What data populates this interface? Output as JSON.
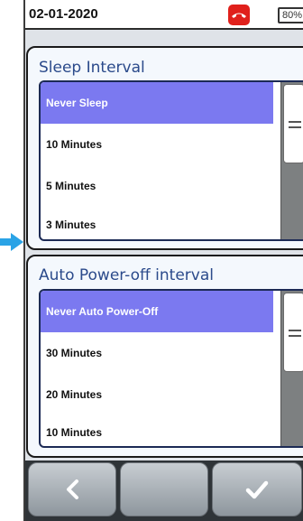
{
  "status": {
    "date": "02-01-2020",
    "battery": "80%"
  },
  "sleep_interval": {
    "title": "Sleep Interval",
    "options": [
      "Never Sleep",
      "10 Minutes",
      "5 Minutes",
      "3 Minutes"
    ],
    "selected": "Never Sleep"
  },
  "auto_power_off": {
    "title": "Auto Power-off interval",
    "options": [
      "Never Auto Power-Off",
      "30 Minutes",
      "20 Minutes",
      "10 Minutes"
    ],
    "selected": "Never Auto Power-Off"
  },
  "colors": {
    "accent": "#7b79f0",
    "title": "#2b4a8b",
    "alert": "#e0201b",
    "pointer": "#2aa3e6"
  },
  "icons": {
    "call": "phone-hangup-icon",
    "back": "chevron-left-icon",
    "confirm": "check-icon",
    "pointer": "arrow-right-icon"
  }
}
